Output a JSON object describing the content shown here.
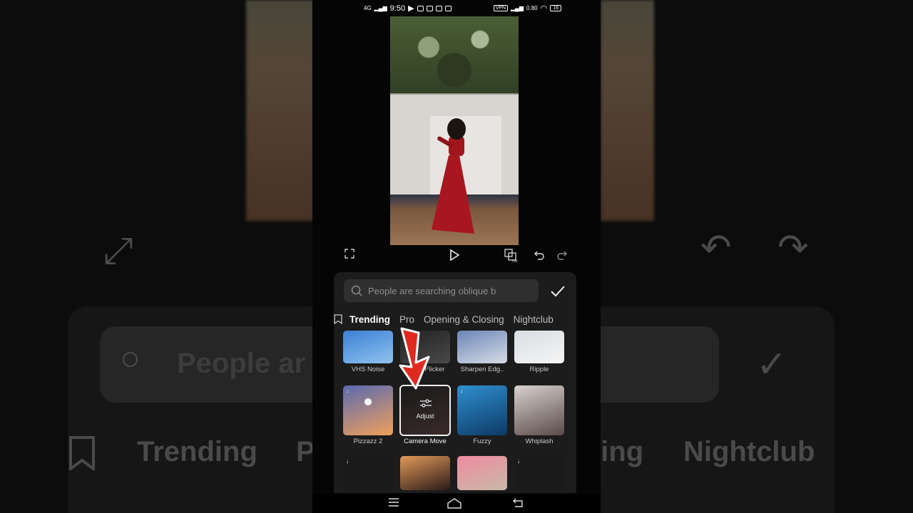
{
  "status": {
    "network": "4G",
    "time": "9:50",
    "vpn": "VPN",
    "speed": "0.80",
    "battery": "16"
  },
  "controls": {
    "fullscreen_icon": "fullscreen-icon",
    "play_icon": "play-icon",
    "split_toggle_icon": "split-on-icon",
    "undo_icon": "undo-icon",
    "redo_icon": "redo-icon"
  },
  "search": {
    "placeholder": "People are searching oblique b"
  },
  "tabs": [
    {
      "label": "Trending"
    },
    {
      "label": "Pro"
    },
    {
      "label": "Opening & Closing"
    },
    {
      "label": "Nightclub"
    }
  ],
  "effects": {
    "row1": [
      {
        "label": "VHS Noise",
        "colors": [
          "#3b7fd4",
          "#8fc3f0"
        ]
      },
      {
        "label": "Glitch Flicker",
        "colors": [
          "#222222",
          "#4a4a4a"
        ]
      },
      {
        "label": "Sharpen Edg..",
        "colors": [
          "#6b86b8",
          "#d7dce5"
        ]
      },
      {
        "label": "Ripple",
        "colors": [
          "#d9dde2",
          "#f5f5f5"
        ]
      }
    ],
    "row2": [
      {
        "label": "Pizzazz 2",
        "colors": [
          "#5a6ab0",
          "#f0a05a"
        ]
      },
      {
        "label": "Camera Move",
        "colors": [
          "#1a1a1a",
          "#3a2a2a"
        ],
        "overlay": "Adjust"
      },
      {
        "label": "Fuzzy",
        "colors": [
          "#2f8fd0",
          "#0d3a66"
        ]
      },
      {
        "label": "Whiplash",
        "colors": [
          "#d8d2d0",
          "#5a4a48"
        ]
      }
    ],
    "row3": [
      {
        "colors": [
          "#1a1a1a",
          "#1a1a1a"
        ]
      },
      {
        "colors": [
          "#e29a5a",
          "#2a1a18"
        ]
      },
      {
        "colors": [
          "#f08aa0",
          "#c8b8a8"
        ]
      },
      {
        "colors": [
          "#1a1a1a",
          "#1a1a1a"
        ]
      }
    ]
  },
  "backdrop": {
    "tab_trending": "Trending",
    "tab_p": "P",
    "tab_sing": "sing",
    "tab_nightclub": "Nightclub",
    "search_text": "People ar"
  },
  "accent": "#e02a1f"
}
